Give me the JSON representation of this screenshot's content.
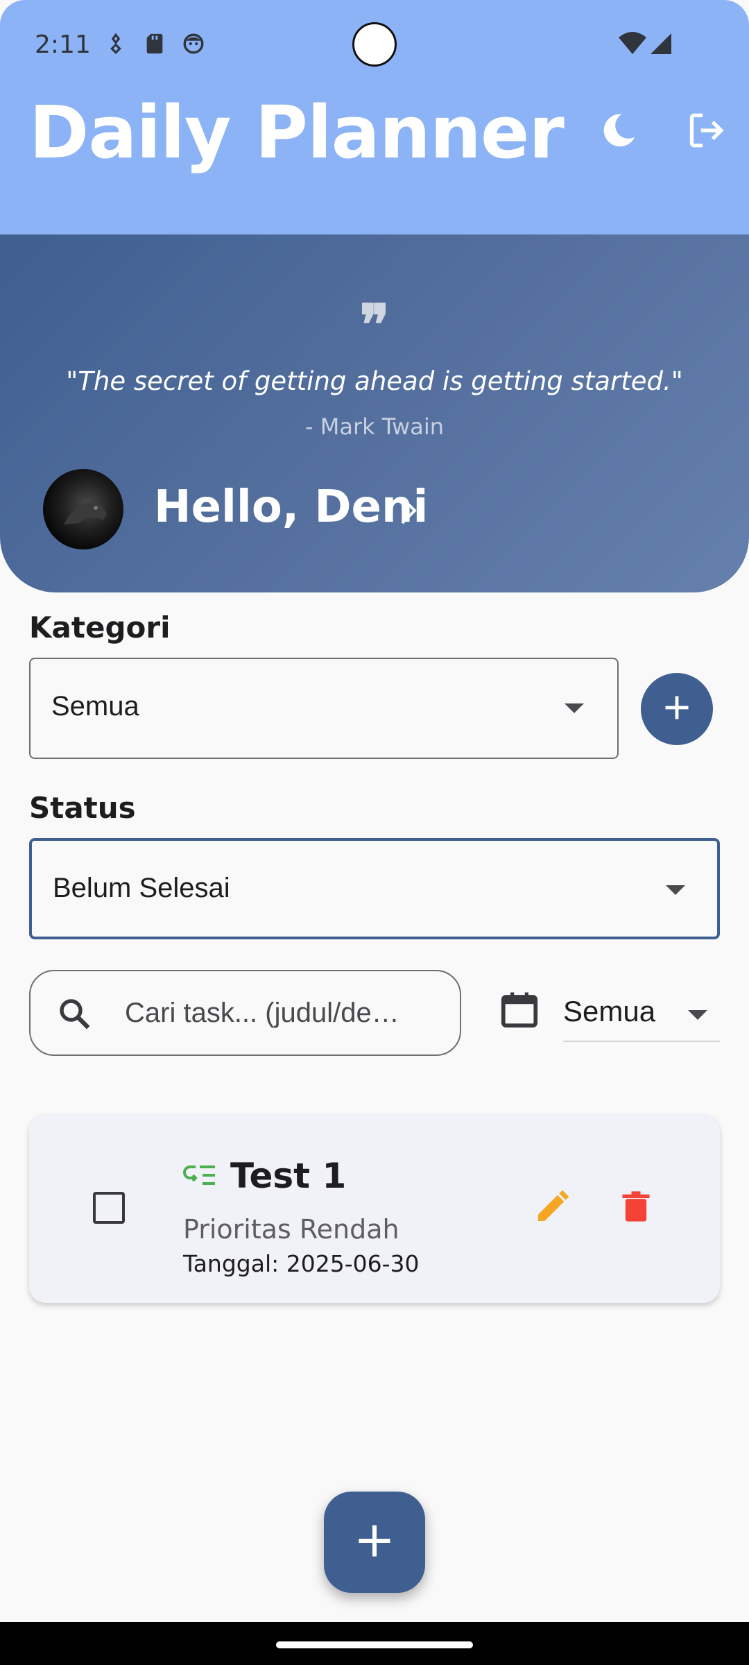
{
  "status_bar": {
    "time": "2:11",
    "icons": [
      "vpn-key-icon",
      "sd-card-icon",
      "face-icon",
      "wifi-icon",
      "signal-icon"
    ]
  },
  "app_bar": {
    "title": "Daily Planner",
    "theme_toggle_icon": "moon-icon",
    "logout_icon": "logout-icon",
    "background": "#8cb3f6"
  },
  "header": {
    "quote_mark": "❞",
    "quote": "\"The secret of getting ahead is getting started.\"",
    "author": "- Mark Twain",
    "greeting": "Hello, Deni",
    "colors": {
      "start": "#3f5f91",
      "end": "#6580ad"
    }
  },
  "filters": {
    "category_label": "Kategori",
    "category_value": "Semua",
    "status_label": "Status",
    "status_value": "Belum Selesai",
    "search_placeholder": "Cari task... (judul/de…",
    "date_value": "Semua"
  },
  "tasks": [
    {
      "title": "Test 1",
      "priority": "Prioritas Rendah",
      "date": "Tanggal: 2025-06-30",
      "checked": false,
      "icon": "low-priority-icon",
      "icon_color": "#4caf50"
    }
  ],
  "colors": {
    "primary": "#3f5f91",
    "edit": "#f5a623",
    "delete": "#f44336"
  }
}
